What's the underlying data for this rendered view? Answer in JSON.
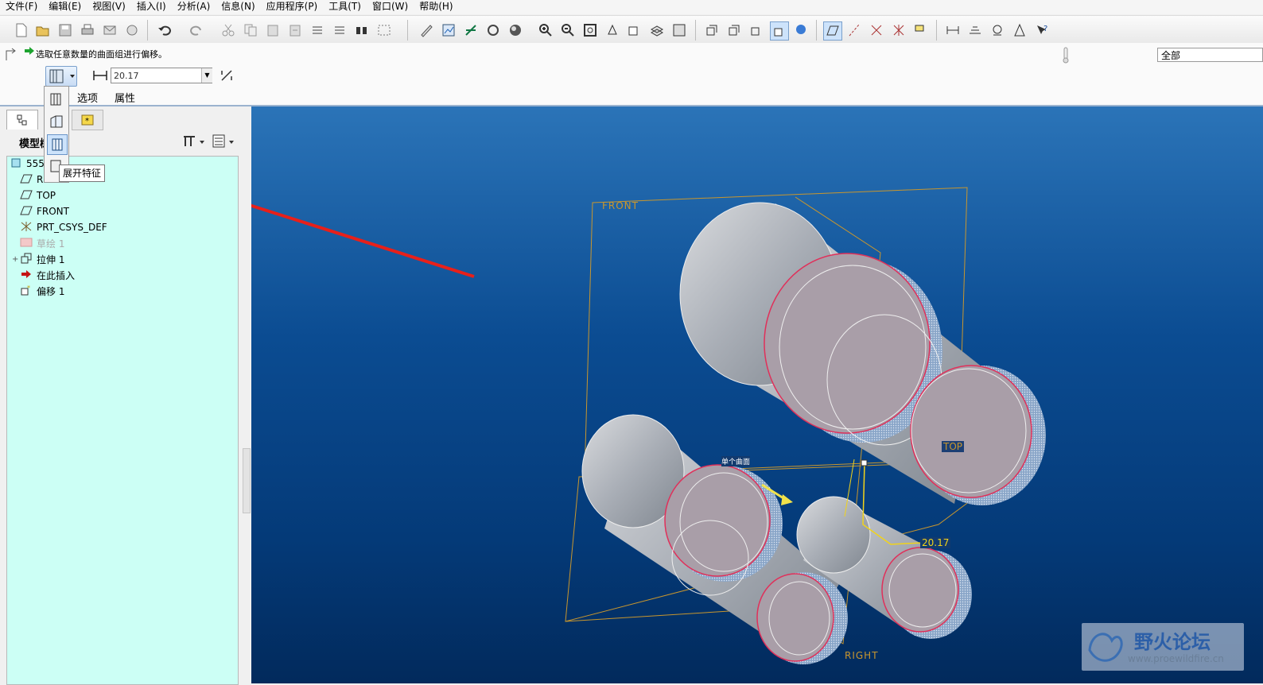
{
  "menubar": [
    "文件(F)",
    "编辑(E)",
    "视图(V)",
    "插入(I)",
    "分析(A)",
    "信息(N)",
    "应用程序(P)",
    "工具(T)",
    "窗口(W)",
    "帮助(H)"
  ],
  "status": {
    "prompt": "选取任意数量的曲面组进行偏移。",
    "filter": "全部"
  },
  "dashboard": {
    "distance_value": "20.17",
    "tabs": [
      "选项",
      "属性"
    ],
    "tooltip": "展开特征"
  },
  "model_tree": {
    "title": "模型树",
    "root": "555.",
    "items": [
      {
        "icon": "datum-plane-icon",
        "label": "RIGHT",
        "state": "normal"
      },
      {
        "icon": "datum-plane-icon",
        "label": "TOP",
        "state": "normal"
      },
      {
        "icon": "datum-plane-icon",
        "label": "FRONT",
        "state": "normal"
      },
      {
        "icon": "csys-icon",
        "label": "PRT_CSYS_DEF",
        "state": "normal"
      },
      {
        "icon": "sketch-icon",
        "label": "草绘 1",
        "state": "dimmed"
      },
      {
        "icon": "extrude-icon",
        "label": "拉伸 1",
        "state": "normal"
      },
      {
        "icon": "insert-here-icon",
        "label": "在此插入",
        "state": "normal"
      },
      {
        "icon": "offset-icon",
        "label": "偏移 1",
        "state": "normal"
      }
    ]
  },
  "viewport": {
    "datum_labels": {
      "front": "FRONT",
      "top": "TOP",
      "right": "RIGHT"
    },
    "dimension": "20.17",
    "surface_label": "单个曲面"
  },
  "watermark": {
    "title": "野火论坛",
    "url": "www.proewildfire.cn"
  },
  "colors": {
    "viewport_top": "#2b74b8",
    "viewport_bottom": "#022a5c",
    "tree_bg": "#ccfff5",
    "arrow": "#e8201a",
    "datum": "#c8962e",
    "highlight": "#e0305a"
  }
}
